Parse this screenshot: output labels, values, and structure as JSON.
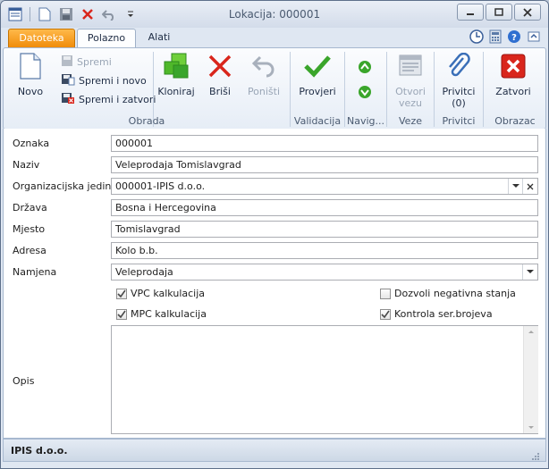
{
  "window": {
    "title": "Lokacija: 000001"
  },
  "tabs": {
    "file": "Datoteka",
    "home": "Polazno",
    "tools": "Alati"
  },
  "ribbon": {
    "obrada": {
      "label": "Obrada",
      "novo": "Novo",
      "spremi": "Spremi",
      "spremi_i_novo": "Spremi i novo",
      "spremi_i_zatvori": "Spremi i zatvori",
      "kloniraj": "Kloniraj",
      "brisi": "Briši",
      "ponisti": "Poništi"
    },
    "validacija": {
      "label": "Validacija",
      "provjeri": "Provjeri"
    },
    "navigacija": {
      "label": "Navig..."
    },
    "veze": {
      "label": "Veze",
      "otvori_vezu_1": "Otvori",
      "otvori_vezu_2": "vezu"
    },
    "privitci": {
      "label": "Privitci",
      "btn_1": "Privitci",
      "btn_2": "(0)"
    },
    "obrazac": {
      "label": "Obrazac",
      "zatvori": "Zatvori"
    }
  },
  "form": {
    "oznaka": {
      "label": "Oznaka",
      "value": "000001"
    },
    "naziv": {
      "label": "Naziv",
      "value": "Veleprodaja Tomislavgrad"
    },
    "org_jedinica": {
      "label": "Organizacijska jedinica",
      "value": "000001-IPIS d.o.o."
    },
    "drzava": {
      "label": "Država",
      "value": "Bosna i Hercegovina"
    },
    "mjesto": {
      "label": "Mjesto",
      "value": "Tomislavgrad"
    },
    "adresa": {
      "label": "Adresa",
      "value": "Kolo b.b."
    },
    "namjena": {
      "label": "Namjena",
      "value": "Veleprodaja"
    },
    "vpc": {
      "label": "VPC kalkulacija",
      "checked": true
    },
    "mpc": {
      "label": "MPC kalkulacija",
      "checked": true
    },
    "negativna": {
      "label": "Dozvoli negativna stanja",
      "checked": false
    },
    "ser_brojeva": {
      "label": "Kontrola ser.brojeva",
      "checked": true
    },
    "opis": {
      "label": "Opis",
      "value": ""
    }
  },
  "status": {
    "company": "IPIS d.o.o."
  },
  "colors": {
    "accent_orange": "#f08c0a",
    "green": "#3aa52b",
    "red": "#d9261c"
  }
}
